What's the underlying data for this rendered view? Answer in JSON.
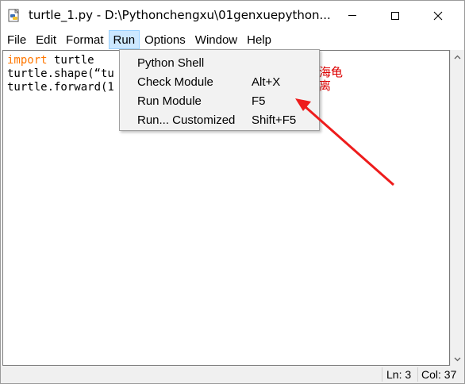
{
  "window": {
    "title": "turtle_1.py - D:\\Pythonchengxu\\01genxuepython..."
  },
  "menubar": {
    "items": [
      {
        "label": "File"
      },
      {
        "label": "Edit"
      },
      {
        "label": "Format"
      },
      {
        "label": "Run"
      },
      {
        "label": "Options"
      },
      {
        "label": "Window"
      },
      {
        "label": "Help"
      }
    ],
    "active": "Run"
  },
  "editor": {
    "lines": [
      {
        "keyword": "import",
        "rest": " turtle"
      },
      {
        "text": "turtle.shape(“tu"
      },
      {
        "text": "turtle.forward(1"
      }
    ],
    "comments": [
      "海龟",
      "离"
    ]
  },
  "run_menu": {
    "items": [
      {
        "label": "Python Shell",
        "accel": ""
      },
      {
        "label": "Check Module",
        "accel": "Alt+X"
      },
      {
        "label": "Run Module",
        "accel": "F5"
      },
      {
        "label": "Run... Customized",
        "accel": "Shift+F5"
      }
    ]
  },
  "statusbar": {
    "ln": "Ln: 3",
    "col": "Col: 37"
  },
  "colors": {
    "keyword": "#ff7700",
    "comment": "#dd0000",
    "annotation_arrow": "#ee1c1c",
    "menu_highlight": "#cce8ff"
  },
  "icons": {
    "app": "python-file-icon",
    "minimize": "minimize-icon",
    "maximize": "maximize-icon",
    "close": "close-icon",
    "scroll_up": "scroll-up-arrow-icon",
    "scroll_down": "scroll-down-arrow-icon"
  }
}
